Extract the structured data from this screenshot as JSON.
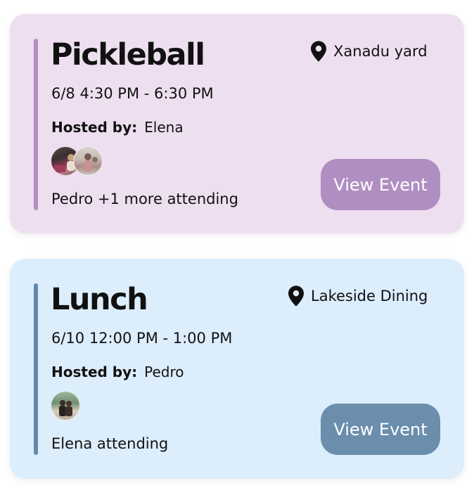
{
  "events": [
    {
      "title": "Pickleball",
      "time": "6/8 4:30 PM - 6:30 PM",
      "host_label": "Hosted by:",
      "host_name": "Elena",
      "location": "Xanadu yard",
      "location_icon": "map-pin-icon",
      "attending_text": "Pedro +1 more attending",
      "avatar_count": 2,
      "button_label": "View Event",
      "colors": {
        "card_bg": "#eedff0",
        "accent": "#b38fc2",
        "button_bg": "#b08ec2"
      }
    },
    {
      "title": "Lunch",
      "time": "6/10 12:00 PM - 1:00 PM",
      "host_label": "Hosted by:",
      "host_name": "Pedro",
      "location": "Lakeside Dining",
      "location_icon": "map-pin-icon",
      "attending_text": "Elena attending",
      "avatar_count": 1,
      "button_label": "View Event",
      "colors": {
        "card_bg": "#dcedfc",
        "accent": "#6389aa",
        "button_bg": "#6a8eab"
      }
    }
  ]
}
